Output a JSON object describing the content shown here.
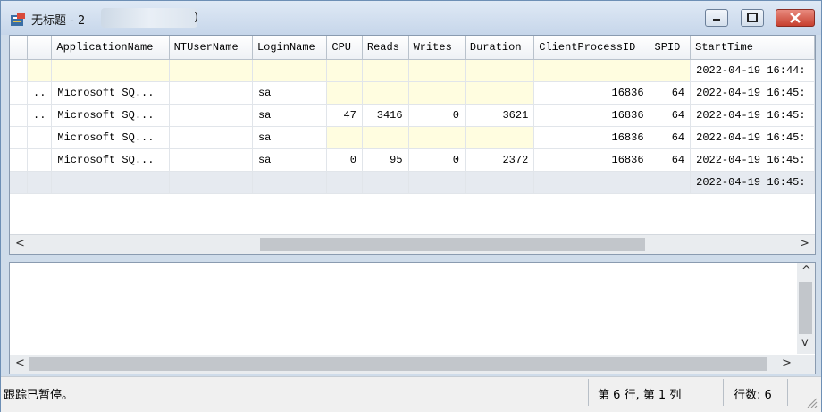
{
  "window": {
    "title": "无标题 - 2"
  },
  "grid": {
    "columns": [
      "",
      "",
      "ApplicationName",
      "NTUserName",
      "LoginName",
      "CPU",
      "Reads",
      "Writes",
      "Duration",
      "ClientProcessID",
      "SPID",
      "StartTime"
    ],
    "rows": [
      [
        "",
        "",
        "",
        "",
        "",
        "",
        "",
        "",
        "",
        "",
        "",
        "2022-04-19 16:44:"
      ],
      [
        "",
        "..",
        "Microsoft SQ...",
        "",
        "sa",
        "",
        "",
        "",
        "",
        "16836",
        "64",
        "2022-04-19 16:45:"
      ],
      [
        "",
        "..",
        "Microsoft SQ...",
        "",
        "sa",
        "47",
        "3416",
        "0",
        "3621",
        "16836",
        "64",
        "2022-04-19 16:45:"
      ],
      [
        "",
        "",
        "Microsoft SQ...",
        "",
        "sa",
        "",
        "",
        "",
        "",
        "16836",
        "64",
        "2022-04-19 16:45:"
      ],
      [
        "",
        "",
        "Microsoft SQ...",
        "",
        "sa",
        "0",
        "95",
        "0",
        "2372",
        "16836",
        "64",
        "2022-04-19 16:45:"
      ],
      [
        "",
        "",
        "",
        "",
        "",
        "",
        "",
        "",
        "",
        "",
        "",
        "2022-04-19 16:45:"
      ]
    ]
  },
  "scroll": {
    "left": "<",
    "right": ">",
    "up": "^",
    "down": "v"
  },
  "status": {
    "message": "跟踪已暂停。",
    "position": "第 6 行, 第 1 列",
    "row_count": "行数: 6"
  }
}
